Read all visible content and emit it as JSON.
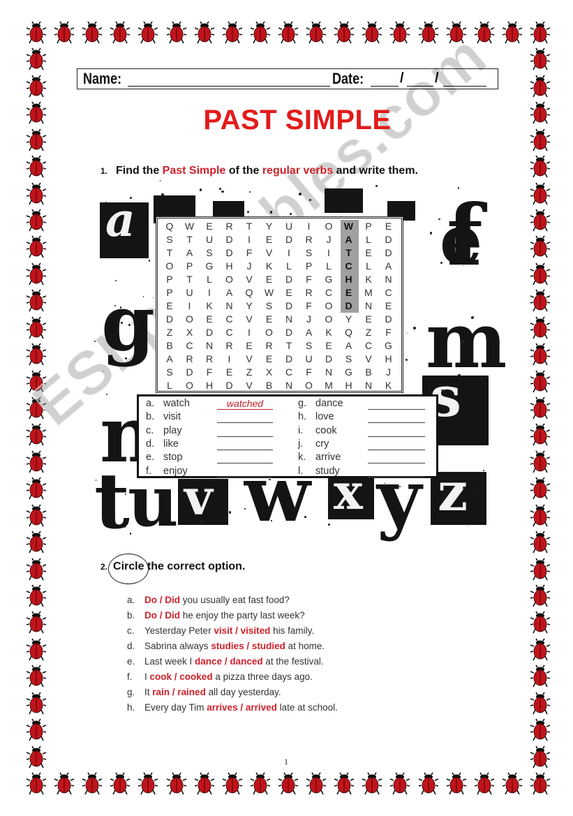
{
  "header": {
    "name_label": "Name:",
    "date_label": "Date:",
    "date_separator": "/"
  },
  "title": "PAST SIMPLE",
  "exercise1": {
    "number": "1.",
    "instruction_parts": [
      {
        "text": "Find the ",
        "highlight": false
      },
      {
        "text": "Past Simple",
        "highlight": true
      },
      {
        "text": " of the ",
        "highlight": false
      },
      {
        "text": "regular verbs",
        "highlight": true
      },
      {
        "text": " and write them.",
        "highlight": false
      }
    ],
    "word_search": {
      "rows": [
        "QWERTYUIOWPE",
        "STUDIEDRJALD",
        "TASDFVISITED",
        "OPGHJKLPLCLA",
        "PTLOVEDFGHKN",
        "PUIAQWERCEMC",
        "EIKNYSDFODNE",
        "DOECVENJOYED",
        "ZXDCIODAKQZF",
        "BCNRERTSEACG",
        "ARRIVEDUDSVH",
        "SDFEZXCFNGBJ",
        "LOHDVBNOMHNK"
      ],
      "highlighted_word": "WATCHED",
      "highlighted_column": 9,
      "highlighted_rows": [
        0,
        6
      ]
    },
    "verbs_left": [
      {
        "letter": "a.",
        "verb": "watch",
        "answer": "watched"
      },
      {
        "letter": "b.",
        "verb": "visit",
        "answer": ""
      },
      {
        "letter": "c.",
        "verb": "play",
        "answer": ""
      },
      {
        "letter": "d.",
        "verb": "like",
        "answer": ""
      },
      {
        "letter": "e.",
        "verb": "stop",
        "answer": ""
      },
      {
        "letter": "f.",
        "verb": "enjoy",
        "answer": ""
      }
    ],
    "verbs_right": [
      {
        "letter": "g.",
        "verb": "dance",
        "answer": ""
      },
      {
        "letter": "h.",
        "verb": "love",
        "answer": ""
      },
      {
        "letter": "i.",
        "verb": "cook",
        "answer": ""
      },
      {
        "letter": "j.",
        "verb": "cry",
        "answer": ""
      },
      {
        "letter": "k.",
        "verb": "arrive",
        "answer": ""
      },
      {
        "letter": "l.",
        "verb": "study",
        "answer": ""
      }
    ],
    "background_letters": [
      "a",
      "e",
      "f",
      "g",
      "m",
      "n",
      "s",
      "t",
      "u",
      "v",
      "w",
      "x",
      "y",
      "z"
    ]
  },
  "exercise2": {
    "number": "2.",
    "instruction_circled": "Circle",
    "instruction_rest": " the correct option.",
    "sentences": [
      {
        "letter": "a.",
        "before": "",
        "opt1": "Do",
        "opt2": "Did",
        "after": " you usually eat fast food?"
      },
      {
        "letter": "b.",
        "before": "",
        "opt1": "Do",
        "opt2": "Did",
        "after": " he enjoy the party last week?"
      },
      {
        "letter": "c.",
        "before": "Yesterday Peter ",
        "opt1": "visit",
        "opt2": "visited",
        "after": " his family."
      },
      {
        "letter": "d.",
        "before": "Sabrina always ",
        "opt1": "studies",
        "opt2": "studied",
        "after": " at home."
      },
      {
        "letter": "e.",
        "before": "Last week I ",
        "opt1": "dance",
        "opt2": "danced",
        "after": " at the festival."
      },
      {
        "letter": "f.",
        "before": "I ",
        "opt1": "cook",
        "opt2": "cooked",
        "after": " a pizza three days ago."
      },
      {
        "letter": "g.",
        "before": "It ",
        "opt1": "rain",
        "opt2": "rained",
        "after": " all day yesterday."
      },
      {
        "letter": "h.",
        "before": "Every day Tim ",
        "opt1": "arrives",
        "opt2": "arrived",
        "after": " late at school."
      }
    ],
    "option_separator": " / "
  },
  "page_number": "1",
  "watermark": "ESLprintables.com",
  "colors": {
    "title_red": "#e31b1b",
    "highlight_red": "#d0202a",
    "ladybug_red": "#c0141c",
    "search_highlight_gray": "#a0a0a0"
  },
  "border": {
    "icon": "ladybug-icon",
    "columns": 19,
    "rows": 29
  }
}
